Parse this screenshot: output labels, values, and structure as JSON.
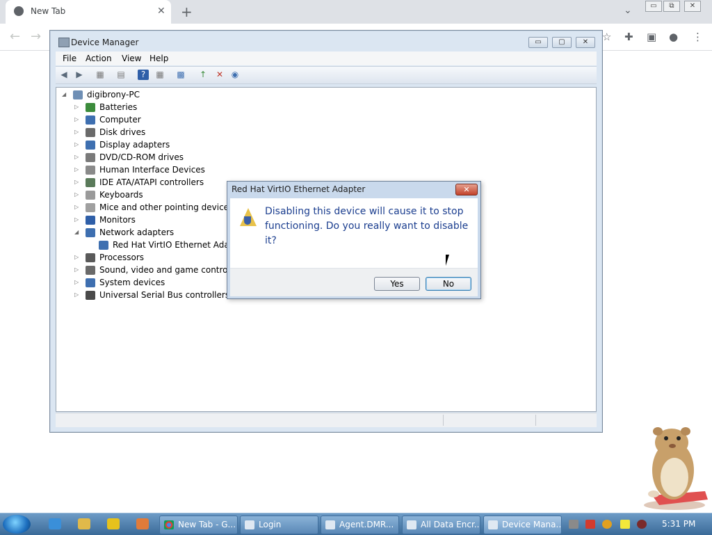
{
  "browser": {
    "tab_title": "New Tab",
    "close_glyph": "✕",
    "new_tab_glyph": "+",
    "search_glyph": "⌄",
    "back_glyph": "←",
    "forward_glyph": "→",
    "toolbar_glyphs": [
      "☆",
      "✚",
      "▣",
      "●",
      "⋮"
    ]
  },
  "os_window_controls": [
    "▭",
    "⧉",
    "✕"
  ],
  "device_manager": {
    "title": "Device Manager",
    "controls": [
      "▭",
      "▢",
      "✕"
    ],
    "menu": [
      "File",
      "Action",
      "View",
      "Help"
    ],
    "toolbar_glyphs": [
      "◀",
      "▶",
      "▦",
      "▤",
      "?",
      "▦",
      "▩",
      "↑",
      "✕",
      "◉"
    ],
    "tree": {
      "root": "digibrony-PC",
      "categories": [
        {
          "label": "Batteries",
          "icon": "battery-icon",
          "color": "#3c8c3c"
        },
        {
          "label": "Computer",
          "icon": "computer-icon",
          "color": "#3e6fb0"
        },
        {
          "label": "Disk drives",
          "icon": "disk-icon",
          "color": "#6a6a6a"
        },
        {
          "label": "Display adapters",
          "icon": "display-icon",
          "color": "#3e6fb0"
        },
        {
          "label": "DVD/CD-ROM drives",
          "icon": "dvd-icon",
          "color": "#7a7a7a"
        },
        {
          "label": "Human Interface Devices",
          "icon": "hid-icon",
          "color": "#8a8a8a"
        },
        {
          "label": "IDE ATA/ATAPI controllers",
          "icon": "ide-icon",
          "color": "#5a7a5a"
        },
        {
          "label": "Keyboards",
          "icon": "keyboard-icon",
          "color": "#9a9a9a"
        },
        {
          "label": "Mice and other pointing devices",
          "icon": "mouse-icon",
          "color": "#a0a0a0"
        },
        {
          "label": "Monitors",
          "icon": "monitor-icon",
          "color": "#2f5fa8"
        },
        {
          "label": "Network adapters",
          "icon": "network-icon",
          "color": "#3e6fb0",
          "expanded": true,
          "children": [
            {
              "label": "Red Hat VirtIO Ethernet Adapter",
              "icon": "network-adapter-icon",
              "color": "#3e6fb0"
            }
          ]
        },
        {
          "label": "Processors",
          "icon": "processor-icon",
          "color": "#5a5a5a"
        },
        {
          "label": "Sound, video and game controllers",
          "icon": "sound-icon",
          "color": "#6a6a6a"
        },
        {
          "label": "System devices",
          "icon": "system-icon",
          "color": "#3e6fb0"
        },
        {
          "label": "Universal Serial Bus controllers",
          "icon": "usb-icon",
          "color": "#4a4a4a"
        }
      ]
    }
  },
  "dialog": {
    "title": "Red Hat VirtIO Ethernet Adapter",
    "close_glyph": "✕",
    "message": "Disabling this device will cause it to stop functioning. Do you really want to disable it?",
    "yes_label": "Yes",
    "no_label": "No"
  },
  "taskbar": {
    "tasks": [
      "New Tab - G...",
      "Login",
      "Agent.DMR...",
      "All Data Encr...",
      "Device Mana..."
    ],
    "clock": "5:31 PM"
  },
  "colors": {
    "dialog_message": "#1b3e8f",
    "taskbar": "#3a6a98"
  }
}
